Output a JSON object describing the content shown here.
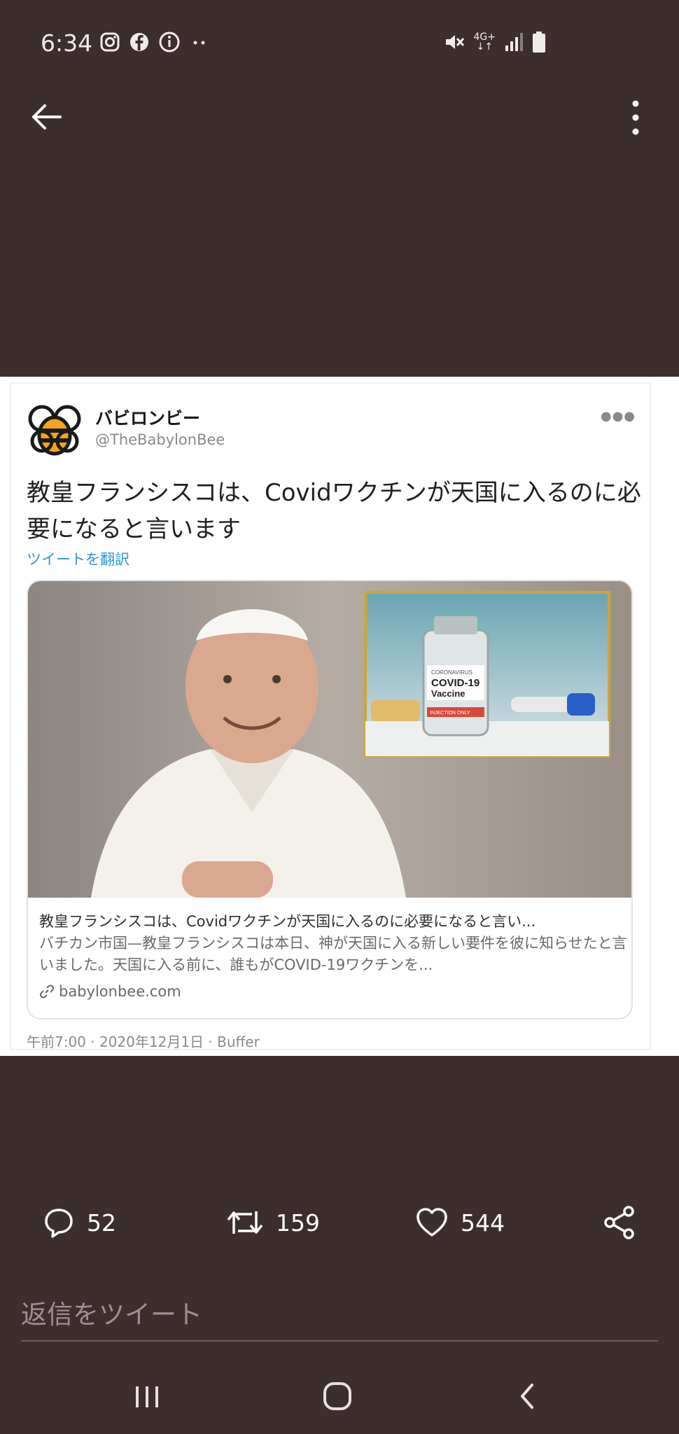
{
  "status_bar": {
    "time": "6:34",
    "icons_left": [
      "instagram-icon",
      "facebook-icon",
      "info-icon",
      "more-notifications-icon"
    ],
    "icons_right": [
      "mute-icon",
      "4g-data-icon",
      "signal-icon",
      "battery-icon"
    ],
    "network_label": "4G+"
  },
  "tweet": {
    "author_name": "バビロンビー",
    "author_handle": "@TheBabylonBee",
    "text": "教皇フランシスコは、Covidワクチンが天国に入るのに必要になると言います",
    "translate_label": "ツイートを翻訳",
    "card": {
      "vial_small_text": "CORONAVIRUS",
      "vial_title": "COVID-19",
      "vial_subtitle": "Vaccine",
      "vial_footer": "INJECTION ONLY",
      "title": "教皇フランシスコは、Covidワクチンが天国に入るのに必要になると言い...",
      "description": "バチカン市国—教皇フランシスコは本日、神が天国に入る新しい要件を彼に知らせたと言いました。天国に入る前に、誰もがCOVID-19ワクチンを...",
      "domain": "babylonbee.com"
    },
    "meta": "午前7:00 · 2020年12月1日 · Buffer"
  },
  "actions": {
    "replies": "52",
    "retweets": "159",
    "likes": "544"
  },
  "reply": {
    "placeholder": "返信をツイート"
  },
  "colors": {
    "background": "#3d2e2e",
    "link": "#2d95d6"
  }
}
